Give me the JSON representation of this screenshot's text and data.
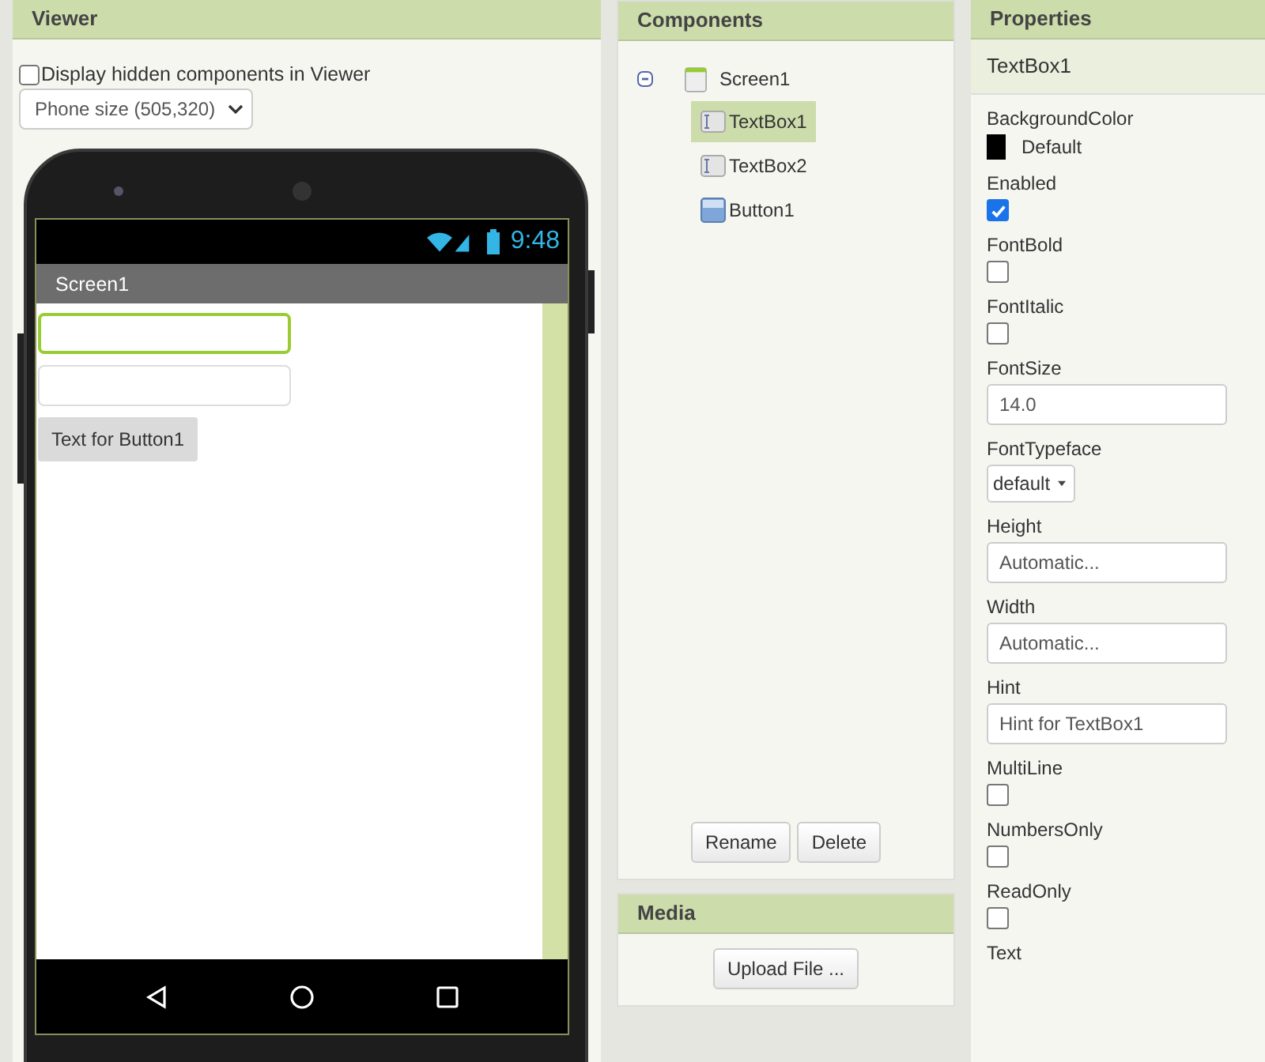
{
  "viewer": {
    "title": "Viewer",
    "hidden_toggle": {
      "label": "Display hidden components in Viewer",
      "checked": false
    },
    "size_select": {
      "value": "Phone size (505,320)"
    },
    "phone": {
      "time": "9:48",
      "screen_title": "Screen1",
      "widgets": [
        {
          "kind": "textbox",
          "selected": true
        },
        {
          "kind": "textbox",
          "selected": false
        },
        {
          "kind": "button",
          "label": "Text for Button1",
          "selected": false
        }
      ]
    }
  },
  "components": {
    "title": "Components",
    "tree": [
      {
        "label": "Screen1",
        "kind": "screen",
        "expanded": true,
        "selected": false,
        "children": [
          {
            "label": "TextBox1",
            "kind": "textbox",
            "selected": true
          },
          {
            "label": "TextBox2",
            "kind": "textbox",
            "selected": false
          },
          {
            "label": "Button1",
            "kind": "button",
            "selected": false
          }
        ]
      }
    ],
    "buttons": [
      "Rename",
      "Delete"
    ]
  },
  "media": {
    "title": "Media",
    "buttons": [
      "Upload File ..."
    ]
  },
  "properties": {
    "title": "Properties",
    "component": "TextBox1",
    "items": [
      {
        "kind": "color",
        "label": "BackgroundColor",
        "value": "Default",
        "color": "#000000"
      },
      {
        "kind": "checkbox",
        "label": "Enabled",
        "checked": true
      },
      {
        "kind": "checkbox",
        "label": "FontBold",
        "checked": false
      },
      {
        "kind": "checkbox",
        "label": "FontItalic",
        "checked": false
      },
      {
        "kind": "text",
        "label": "FontSize",
        "value": "14.0"
      },
      {
        "kind": "dropdown",
        "label": "FontTypeface",
        "value": "default"
      },
      {
        "kind": "text",
        "label": "Height",
        "value": "Automatic..."
      },
      {
        "kind": "text",
        "label": "Width",
        "value": "Automatic..."
      },
      {
        "kind": "text",
        "label": "Hint",
        "value": "Hint for TextBox1"
      },
      {
        "kind": "checkbox",
        "label": "MultiLine",
        "checked": false
      },
      {
        "kind": "checkbox",
        "label": "NumbersOnly",
        "checked": false
      },
      {
        "kind": "checkbox",
        "label": "ReadOnly",
        "checked": false
      },
      {
        "kind": "label",
        "label": "Text"
      }
    ]
  }
}
